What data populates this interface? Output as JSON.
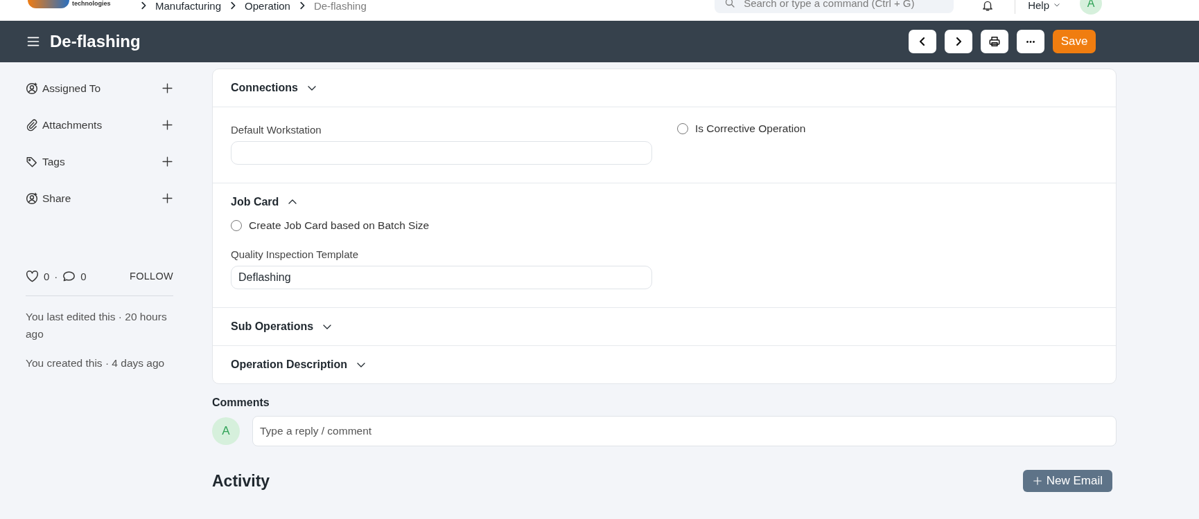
{
  "navbar": {
    "logo_text": "technologies",
    "breadcrumbs": [
      {
        "label": "Manufacturing",
        "current": false
      },
      {
        "label": "Operation",
        "current": false
      },
      {
        "label": "De-flashing",
        "current": true
      }
    ],
    "search": {
      "placeholder": "Search or type a command (Ctrl + G)"
    },
    "help": "Help",
    "avatar": "A"
  },
  "header": {
    "title": "De-flashing",
    "buttons": [
      {
        "kind": "prev"
      },
      {
        "kind": "next"
      },
      {
        "kind": "print"
      },
      {
        "kind": "more"
      },
      {
        "kind": "save",
        "label": "Save"
      }
    ]
  },
  "sidebar": {
    "actions": [
      {
        "kind": "assign",
        "label": "Assigned To"
      },
      {
        "kind": "attach",
        "label": "Attachments"
      },
      {
        "kind": "tag",
        "label": "Tags"
      },
      {
        "kind": "share",
        "label": "Share"
      }
    ],
    "likes": "0",
    "separator": "·",
    "comments": "0",
    "follow": "FOLLOW",
    "activity": [
      "You last edited this · 20 hours ago",
      "You created this · 4 days ago"
    ]
  },
  "form": {
    "sections": [
      {
        "title": "Connections",
        "expanded": false
      },
      {
        "columns": [
          [
            {
              "kind": "input",
              "label": "Default Workstation"
            }
          ],
          [
            {
              "kind": "checkbox",
              "label": "Is Corrective Operation",
              "checked": false
            }
          ]
        ]
      },
      {
        "title": "Job Card",
        "expanded": true,
        "columns": [
          [
            {
              "kind": "checkbox",
              "label": "Create Job Card based on Batch Size",
              "checked": false
            },
            {
              "kind": "input",
              "label": "Quality Inspection Template",
              "value": "Deflashing"
            }
          ]
        ]
      },
      {
        "title": "Sub Operations",
        "expanded": false
      },
      {
        "title": "Operation Description",
        "expanded": false
      }
    ]
  },
  "comments": {
    "title": "Comments",
    "avatar": "A",
    "placeholder": "Type a reply / comment"
  },
  "activity": {
    "title": "Activity",
    "button": "New Email"
  }
}
